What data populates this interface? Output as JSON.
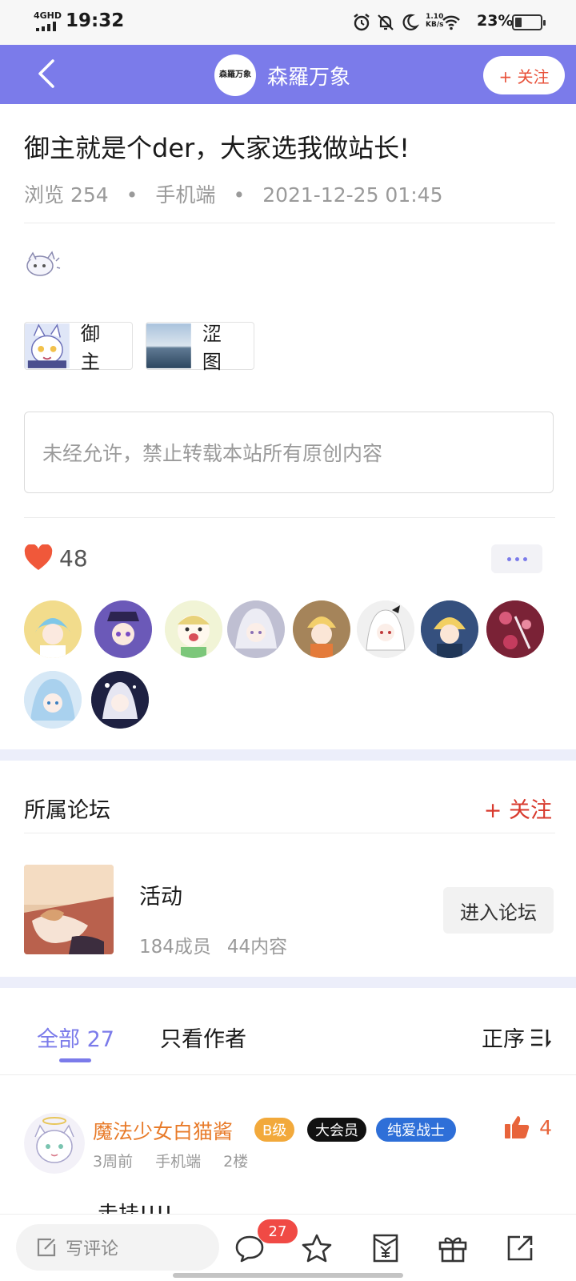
{
  "status_bar": {
    "network": "4GHD",
    "time": "19:32",
    "speed_value": "1.10",
    "speed_unit": "KB/s",
    "battery": "23%"
  },
  "header": {
    "logo_text": "森羅万象",
    "title": "森羅万象",
    "follow_label": "+ 关注",
    "bg_color": "#7b7bea"
  },
  "post": {
    "title": "御主就是个der，大家选我做站长!",
    "views": "浏览 254",
    "device": "手机端",
    "date": "2021-12-25 01:45",
    "tags": [
      {
        "label": "御主",
        "icon": "anime-avatar-thumb"
      },
      {
        "label": "涩图",
        "icon": "sea-horizon-thumb"
      }
    ],
    "notice": "未经允许，禁止转载本站所有原创内容"
  },
  "likes": {
    "count": "48",
    "heart_color": "#f0583a"
  },
  "liked_avatars": [
    {
      "name": "liker-1"
    },
    {
      "name": "liker-2"
    },
    {
      "name": "liker-3"
    },
    {
      "name": "liker-4"
    },
    {
      "name": "liker-5"
    },
    {
      "name": "liker-6"
    },
    {
      "name": "liker-7"
    },
    {
      "name": "liker-8"
    },
    {
      "name": "liker-9"
    },
    {
      "name": "liker-10"
    }
  ],
  "forum": {
    "section_title": "所属论坛",
    "follow_label": "+ 关注",
    "name": "活动",
    "members": "184成员",
    "contents": "44内容",
    "enter_label": "进入论坛"
  },
  "tabs": {
    "all": "全部 27",
    "author_only": "只看作者",
    "sort": "正序"
  },
  "comment": {
    "username": "魔法少女白猫酱",
    "badges": [
      "B级",
      "大会员",
      "纯爱战士"
    ],
    "time": "3周前",
    "device": "手机端",
    "floor": "2楼",
    "likes": "4",
    "text": "走挂!!!!"
  },
  "bottom_bar": {
    "write_placeholder": "写评论",
    "comment_count": "27"
  }
}
